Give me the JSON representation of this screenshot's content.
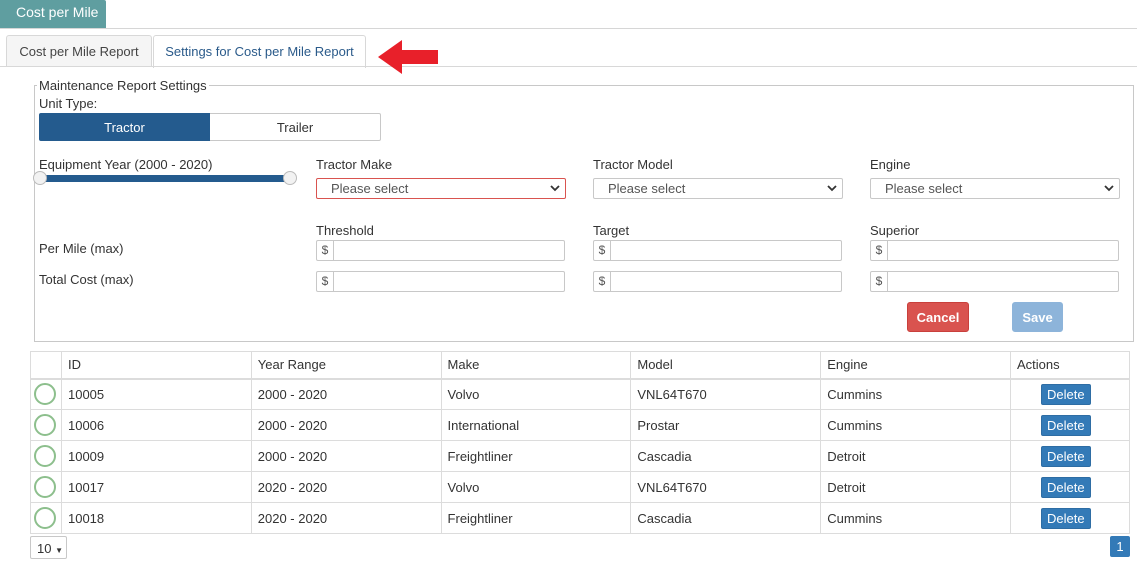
{
  "header": {
    "title": "Cost per Mile"
  },
  "tabs": [
    {
      "label": "Cost per Mile Report"
    },
    {
      "label": "Settings for Cost per Mile Report"
    }
  ],
  "colors": {
    "primary": "#245b8e",
    "teal": "#5f9ea0",
    "danger": "#d9534f",
    "arrow": "#e8202a"
  },
  "settings": {
    "legend": "Maintenance Report Settings",
    "unit_type_label": "Unit Type:",
    "unit_types": [
      "Tractor",
      "Trailer"
    ],
    "equipment_year_label": "Equipment Year (2000 - 2020)",
    "tractor_make_label": "Tractor Make",
    "tractor_model_label": "Tractor Model",
    "engine_label": "Engine",
    "select_placeholder": "Please select",
    "threshold_label": "Threshold",
    "target_label": "Target",
    "superior_label": "Superior",
    "per_mile_label": "Per Mile (max)",
    "total_cost_label": "Total Cost (max)",
    "currency_symbol": "$",
    "cancel_label": "Cancel",
    "save_label": "Save"
  },
  "table": {
    "columns": [
      "ID",
      "Year Range",
      "Make",
      "Model",
      "Engine",
      "Actions"
    ],
    "delete_label": "Delete",
    "rows": [
      {
        "id": "10005",
        "year_range": "2000 - 2020",
        "make": "Volvo",
        "model": "VNL64T670",
        "engine": "Cummins"
      },
      {
        "id": "10006",
        "year_range": "2000 - 2020",
        "make": "International",
        "model": "Prostar",
        "engine": "Cummins"
      },
      {
        "id": "10009",
        "year_range": "2000 - 2020",
        "make": "Freightliner",
        "model": "Cascadia",
        "engine": "Detroit"
      },
      {
        "id": "10017",
        "year_range": "2020 - 2020",
        "make": "Volvo",
        "model": "VNL64T670",
        "engine": "Detroit"
      },
      {
        "id": "10018",
        "year_range": "2020 - 2020",
        "make": "Freightliner",
        "model": "Cascadia",
        "engine": "Cummins"
      }
    ]
  },
  "pagination": {
    "page_size": "10",
    "current_page": "1"
  }
}
